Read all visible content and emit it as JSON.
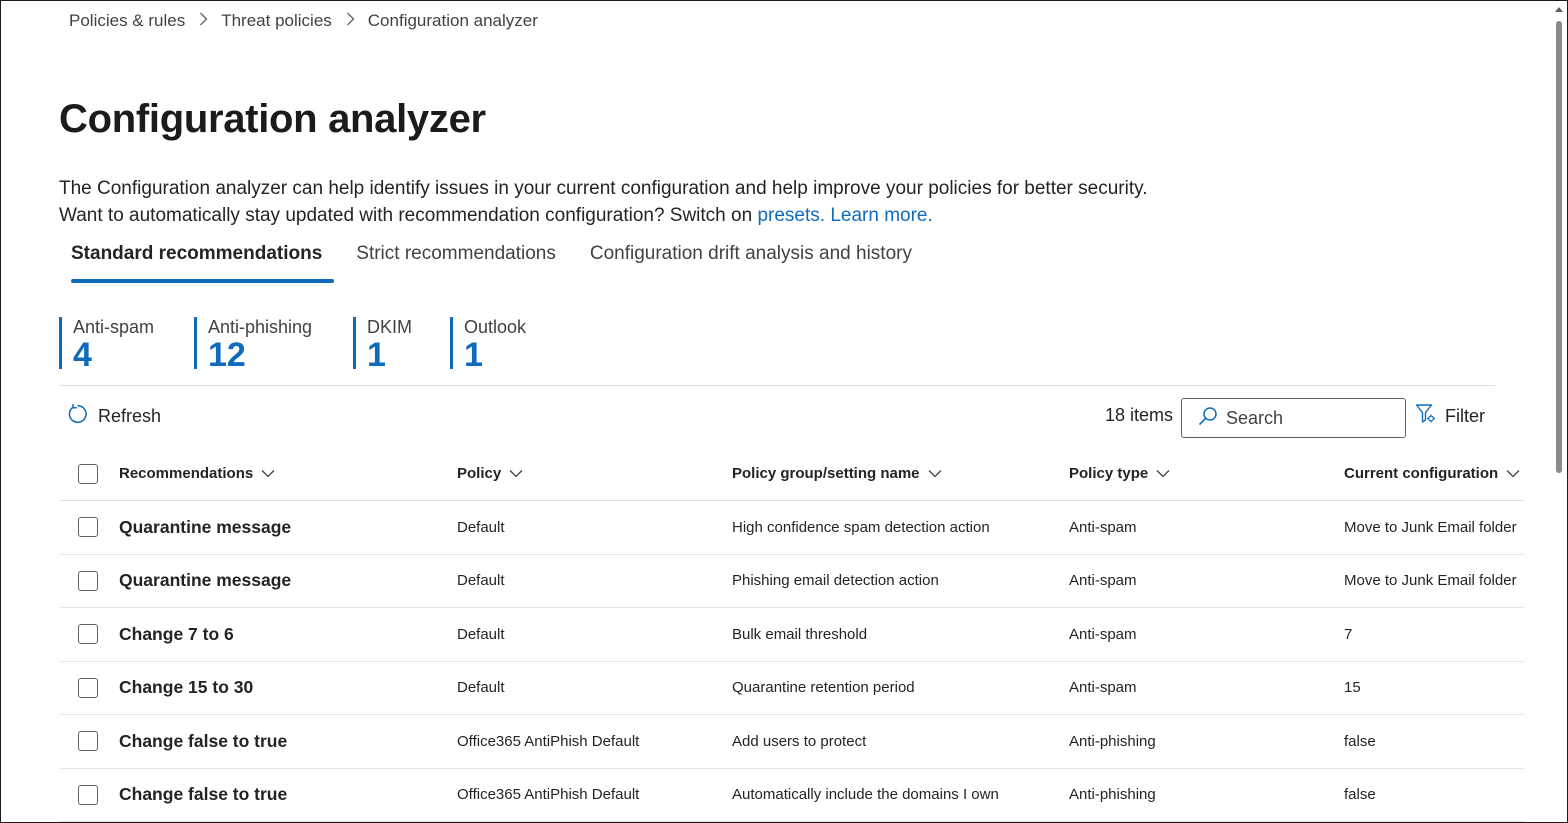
{
  "breadcrumb": {
    "items": [
      "Policies & rules",
      "Threat policies",
      "Configuration analyzer"
    ]
  },
  "page": {
    "title": "Configuration analyzer",
    "description_text": "The Configuration analyzer can help identify issues in your current configuration and help improve your policies for better security. Want to automatically stay updated with recommendation configuration? Switch on ",
    "presets_link": "presets.",
    "learn_more_link": "Learn more."
  },
  "tabs": [
    {
      "label": "Standard recommendations",
      "active": true
    },
    {
      "label": "Strict recommendations",
      "active": false
    },
    {
      "label": "Configuration drift analysis and history",
      "active": false
    }
  ],
  "stats": [
    {
      "label": "Anti-spam",
      "value": "4"
    },
    {
      "label": "Anti-phishing",
      "value": "12"
    },
    {
      "label": "DKIM",
      "value": "1"
    },
    {
      "label": "Outlook",
      "value": "1"
    }
  ],
  "toolbar": {
    "refresh_label": "Refresh",
    "items_count": "18 items",
    "search_placeholder": "Search",
    "filter_label": "Filter"
  },
  "table": {
    "columns": [
      "Recommendations",
      "Policy",
      "Policy group/setting name",
      "Policy type",
      "Current configuration"
    ],
    "rows": [
      [
        "Quarantine message",
        "Default",
        "High confidence spam detection action",
        "Anti-spam",
        "Move to Junk Email folder"
      ],
      [
        "Quarantine message",
        "Default",
        "Phishing email detection action",
        "Anti-spam",
        "Move to Junk Email folder"
      ],
      [
        "Change 7 to 6",
        "Default",
        "Bulk email threshold",
        "Anti-spam",
        "7"
      ],
      [
        "Change 15 to 30",
        "Default",
        "Quarantine retention period",
        "Anti-spam",
        "15"
      ],
      [
        "Change false to true",
        "Office365 AntiPhish Default",
        "Add users to protect",
        "Anti-phishing",
        "false"
      ],
      [
        "Change false to true",
        "Office365 AntiPhish Default",
        "Automatically include the domains I own",
        "Anti-phishing",
        "false"
      ]
    ]
  },
  "colors": {
    "accent": "#0f6cbd",
    "text": "#242424",
    "divider": "#e0e0e0"
  }
}
